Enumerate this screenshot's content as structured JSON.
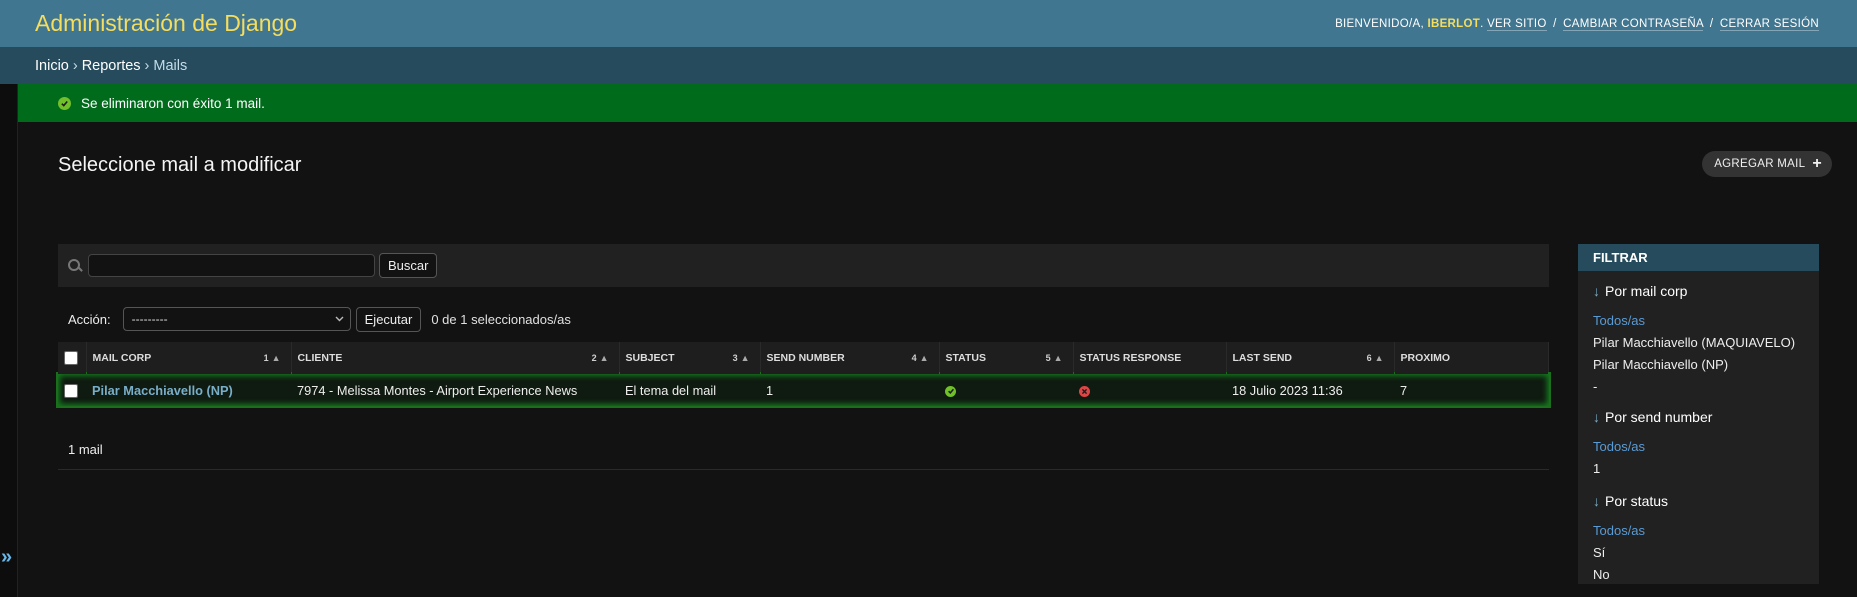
{
  "header": {
    "site_name": "Administración de Django",
    "welcome": "Bienvenido/a,",
    "username": "IBERLOT",
    "links": {
      "view_site": "Ver sitio",
      "change_password": "Cambiar contraseña",
      "logout": "Cerrar sesión"
    },
    "separator": "/"
  },
  "breadcrumbs": {
    "home": "Inicio",
    "app": "Reportes",
    "current": "Mails",
    "separator": "›"
  },
  "message": {
    "text": "Se eliminaron con éxito 1 mail.",
    "type": "success"
  },
  "page": {
    "title": "Seleccione mail a modificar",
    "add_button": "Agregar mail"
  },
  "search": {
    "value": "",
    "button": "Buscar"
  },
  "actions": {
    "label": "Acción:",
    "selected_option": "---------",
    "execute": "Ejecutar",
    "counter": "0 de 1 seleccionados/as"
  },
  "table": {
    "columns": [
      {
        "label": "Mail corp",
        "sort_priority": "1"
      },
      {
        "label": "Cliente",
        "sort_priority": "2"
      },
      {
        "label": "Subject",
        "sort_priority": "3"
      },
      {
        "label": "Send number",
        "sort_priority": "4"
      },
      {
        "label": "Status",
        "sort_priority": "5"
      },
      {
        "label": "Status response",
        "sort_priority": ""
      },
      {
        "label": "Last send",
        "sort_priority": "6"
      },
      {
        "label": "Proximo",
        "sort_priority": ""
      }
    ],
    "rows": [
      {
        "mail_corp": "Pilar Macchiavello (NP)",
        "cliente": "7974 - Melissa Montes - Airport Experience News",
        "subject": "El tema del mail",
        "send_number": "1",
        "status": "yes-icon",
        "status_response": "no-icon",
        "last_send": "18 Julio 2023 11:36",
        "proximo": "7"
      }
    ],
    "count_text": "1 mail"
  },
  "filter": {
    "title": "Filtrar",
    "sections": [
      {
        "title": "Por mail corp",
        "options": [
          "Todos/as",
          "Pilar Macchiavello (MAQUIAVELO)",
          "Pilar Macchiavello (NP)",
          "-"
        ]
      },
      {
        "title": "Por send number",
        "options": [
          "Todos/as",
          "1"
        ]
      },
      {
        "title": "Por status",
        "options": [
          "Todos/as",
          "Sí",
          "No"
        ]
      }
    ]
  },
  "sidebar_toggle": "»",
  "colors": {
    "header_bg": "#417690",
    "breadcrumbs_bg": "#264b5d",
    "site_name": "#f5dd5d",
    "success_bg": "#006b1b",
    "link": "#79aec8",
    "body_bg": "#121212"
  }
}
